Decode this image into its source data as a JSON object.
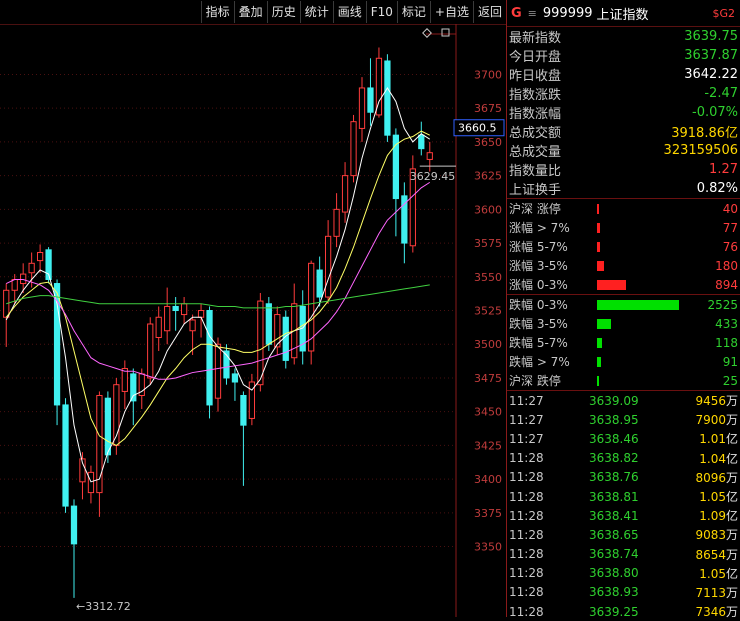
{
  "toolbar": {
    "buttons": [
      "指标",
      "叠加",
      "历史",
      "统计",
      "画线",
      "F10",
      "标记",
      "+自选",
      "返回"
    ]
  },
  "chart": {
    "y_ticks": [
      "3700",
      "3675",
      "3650",
      "3625",
      "3600",
      "3575",
      "3550",
      "3525",
      "3500",
      "3475",
      "3450",
      "3425",
      "3400",
      "3375",
      "3350"
    ],
    "cursor_price": "3660.5",
    "high_marker": "3629.45",
    "low_marker": "←3312.72"
  },
  "chart_data": {
    "type": "candlestick",
    "ylim": [
      3300,
      3730
    ],
    "candles": [
      [
        3520,
        3540,
        3498,
        3545
      ],
      [
        3540,
        3548,
        3530,
        3552
      ],
      [
        3545,
        3552,
        3538,
        3560
      ],
      [
        3553,
        3560,
        3542,
        3568
      ],
      [
        3562,
        3568,
        3553,
        3574
      ],
      [
        3570,
        3548,
        3545,
        3572
      ],
      [
        3545,
        3455,
        3440,
        3548
      ],
      [
        3455,
        3380,
        3375,
        3460
      ],
      [
        3380,
        3352,
        3312,
        3385
      ],
      [
        3398,
        3415,
        3385,
        3420
      ],
      [
        3390,
        3405,
        3382,
        3410
      ],
      [
        3390,
        3462,
        3372,
        3465
      ],
      [
        3460,
        3418,
        3412,
        3465
      ],
      [
        3425,
        3470,
        3418,
        3475
      ],
      [
        3465,
        3482,
        3452,
        3488
      ],
      [
        3478,
        3458,
        3440,
        3482
      ],
      [
        3462,
        3478,
        3452,
        3482
      ],
      [
        3475,
        3515,
        3470,
        3520
      ],
      [
        3505,
        3520,
        3495,
        3528
      ],
      [
        3510,
        3528,
        3500,
        3542
      ],
      [
        3528,
        3525,
        3510,
        3535
      ],
      [
        3522,
        3530,
        3515,
        3535
      ],
      [
        3510,
        3518,
        3492,
        3522
      ],
      [
        3520,
        3525,
        3505,
        3530
      ],
      [
        3525,
        3455,
        3445,
        3528
      ],
      [
        3460,
        3500,
        3450,
        3505
      ],
      [
        3495,
        3475,
        3470,
        3500
      ],
      [
        3478,
        3472,
        3458,
        3482
      ],
      [
        3462,
        3440,
        3395,
        3465
      ],
      [
        3445,
        3472,
        3440,
        3478
      ],
      [
        3470,
        3532,
        3465,
        3538
      ],
      [
        3530,
        3500,
        3495,
        3535
      ],
      [
        3498,
        3522,
        3492,
        3528
      ],
      [
        3520,
        3488,
        3482,
        3525
      ],
      [
        3490,
        3530,
        3485,
        3545
      ],
      [
        3528,
        3495,
        3485,
        3540
      ],
      [
        3495,
        3560,
        3485,
        3562
      ],
      [
        3555,
        3535,
        3528,
        3565
      ],
      [
        3535,
        3580,
        3530,
        3592
      ],
      [
        3580,
        3600,
        3572,
        3612
      ],
      [
        3598,
        3625,
        3590,
        3635
      ],
      [
        3625,
        3665,
        3620,
        3670
      ],
      [
        3660,
        3690,
        3650,
        3698
      ],
      [
        3690,
        3672,
        3662,
        3712
      ],
      [
        3670,
        3712,
        3668,
        3720
      ],
      [
        3710,
        3655,
        3650,
        3715
      ],
      [
        3655,
        3608,
        3580,
        3660
      ],
      [
        3610,
        3575,
        3560,
        3620
      ],
      [
        3573,
        3630,
        3568,
        3640
      ],
      [
        3655,
        3645,
        3640,
        3665
      ],
      [
        3637,
        3642,
        3628,
        3650
      ]
    ],
    "ma_lines": [
      {
        "color": "#ffffff",
        "values": [
          3518,
          3530,
          3540,
          3548,
          3555,
          3552,
          3530,
          3490,
          3440,
          3412,
          3398,
          3400,
          3420,
          3432,
          3450,
          3462,
          3465,
          3470,
          3480,
          3495,
          3505,
          3515,
          3520,
          3520,
          3506,
          3498,
          3492,
          3484,
          3470,
          3466,
          3474,
          3490,
          3500,
          3506,
          3510,
          3512,
          3520,
          3530,
          3548,
          3565,
          3585,
          3610,
          3638,
          3660,
          3680,
          3690,
          3680,
          3660,
          3650,
          3656,
          3652
        ]
      },
      {
        "color": "#ffff66",
        "values": [
          3520,
          3528,
          3535,
          3540,
          3545,
          3546,
          3538,
          3520,
          3495,
          3470,
          3445,
          3432,
          3428,
          3425,
          3430,
          3438,
          3446,
          3455,
          3465,
          3475,
          3482,
          3490,
          3496,
          3500,
          3500,
          3498,
          3497,
          3496,
          3494,
          3494,
          3496,
          3500,
          3504,
          3508,
          3510,
          3514,
          3518,
          3524,
          3532,
          3542,
          3556,
          3572,
          3590,
          3608,
          3625,
          3640,
          3648,
          3652,
          3654,
          3658,
          3655
        ]
      },
      {
        "color": "#ff66ff",
        "values": [
          3545,
          3548,
          3548,
          3546,
          3544,
          3540,
          3532,
          3522,
          3510,
          3500,
          3490,
          3486,
          3484,
          3482,
          3480,
          3480,
          3478,
          3476,
          3474,
          3474,
          3475,
          3477,
          3479,
          3480,
          3481,
          3482,
          3483,
          3484,
          3485,
          3486,
          3488,
          3490,
          3492,
          3494,
          3497,
          3500,
          3504,
          3510,
          3516,
          3524,
          3534,
          3546,
          3558,
          3570,
          3582,
          3592,
          3598,
          3604,
          3610,
          3616,
          3620
        ]
      },
      {
        "color": "#40d040",
        "values": [
          3530,
          3532,
          3534,
          3535,
          3536,
          3536,
          3535,
          3534,
          3533,
          3532,
          3531,
          3530,
          3530,
          3530,
          3530,
          3530,
          3530,
          3530,
          3530,
          3530,
          3530,
          3530,
          3530,
          3530,
          3529,
          3528,
          3528,
          3528,
          3527,
          3527,
          3527,
          3527,
          3527,
          3528,
          3528,
          3529,
          3530,
          3531,
          3532,
          3533,
          3534,
          3535,
          3536,
          3537,
          3538,
          3539,
          3540,
          3541,
          3542,
          3543,
          3544
        ]
      }
    ]
  },
  "header": {
    "g_label": "G",
    "menu": "≡",
    "code": "999999",
    "name": "上证指数",
    "sg": "$G2"
  },
  "stats": [
    {
      "label": "最新指数",
      "value": "3639.75",
      "color": "#2fd02f"
    },
    {
      "label": "今日开盘",
      "value": "3637.87",
      "color": "#2fd02f"
    },
    {
      "label": "昨日收盘",
      "value": "3642.22",
      "color": "#ffffff"
    },
    {
      "label": "指数涨跌",
      "value": "-2.47",
      "color": "#2fd02f"
    },
    {
      "label": "指数涨幅",
      "value": "-0.07%",
      "color": "#2fd02f"
    },
    {
      "label": "总成交额",
      "value": "3918.86亿",
      "color": "#ffd700"
    },
    {
      "label": "总成交量",
      "value": "323159506",
      "color": "#ffd700"
    },
    {
      "label": "指数量比",
      "value": "1.27",
      "color": "#ff3c3c"
    },
    {
      "label": "上证换手",
      "value": "0.82%",
      "color": "#ffffff"
    }
  ],
  "up_dist": [
    {
      "label": "沪深 涨停",
      "value": "40",
      "frac": 0.005
    },
    {
      "label": "涨幅 > 7%",
      "value": "77",
      "frac": 0.012
    },
    {
      "label": "涨幅 5-7%",
      "value": "76",
      "frac": 0.012
    },
    {
      "label": "涨幅 3-5%",
      "value": "180",
      "frac": 0.03
    },
    {
      "label": "涨幅 0-3%",
      "value": "894",
      "frac": 0.12
    }
  ],
  "down_dist": [
    {
      "label": "跌幅 0-3%",
      "value": "2525",
      "frac": 0.34
    },
    {
      "label": "跌幅 3-5%",
      "value": "433",
      "frac": 0.06
    },
    {
      "label": "跌幅 5-7%",
      "value": "118",
      "frac": 0.02
    },
    {
      "label": "跌幅 > 7%",
      "value": "91",
      "frac": 0.015
    },
    {
      "label": "沪深 跌停",
      "value": "25",
      "frac": 0.005
    }
  ],
  "ticks": [
    {
      "time": "11:27",
      "price": "3639.09",
      "vol": "9456",
      "unit": "万"
    },
    {
      "time": "11:27",
      "price": "3638.95",
      "vol": "7900",
      "unit": "万"
    },
    {
      "time": "11:27",
      "price": "3638.46",
      "vol": "1.01",
      "unit": "亿"
    },
    {
      "time": "11:28",
      "price": "3638.82",
      "vol": "1.04",
      "unit": "亿"
    },
    {
      "time": "11:28",
      "price": "3638.76",
      "vol": "8096",
      "unit": "万"
    },
    {
      "time": "11:28",
      "price": "3638.81",
      "vol": "1.05",
      "unit": "亿"
    },
    {
      "time": "11:28",
      "price": "3638.41",
      "vol": "1.09",
      "unit": "亿"
    },
    {
      "time": "11:28",
      "price": "3638.65",
      "vol": "9083",
      "unit": "万"
    },
    {
      "time": "11:28",
      "price": "3638.74",
      "vol": "8654",
      "unit": "万"
    },
    {
      "time": "11:28",
      "price": "3638.80",
      "vol": "1.05",
      "unit": "亿"
    },
    {
      "time": "11:28",
      "price": "3638.93",
      "vol": "7113",
      "unit": "万"
    },
    {
      "time": "11:28",
      "price": "3639.25",
      "vol": "7346",
      "unit": "万"
    }
  ],
  "colors": {
    "up": "#ff3c3c",
    "down": "#40f0f0",
    "green": "#2fd02f",
    "yellow": "#ffd700",
    "bar_up": "#ff2020",
    "bar_down": "#00e000"
  }
}
